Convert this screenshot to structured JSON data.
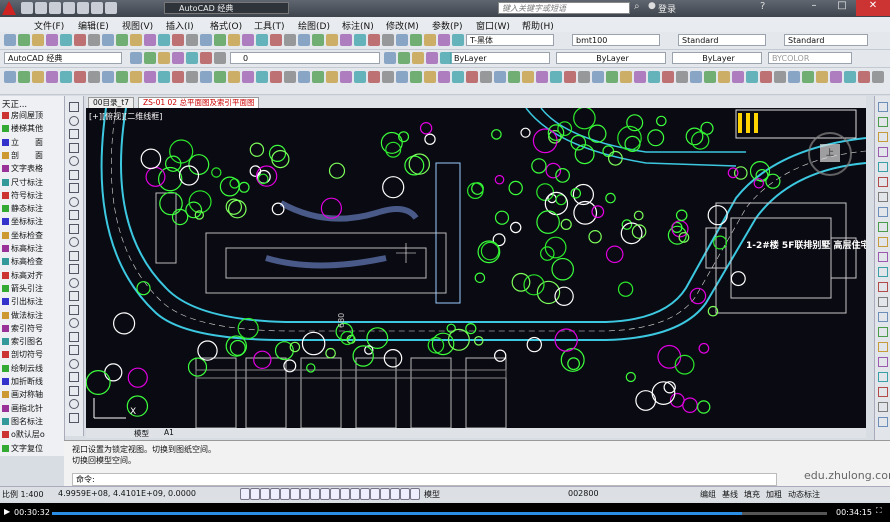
{
  "titlebar": {
    "app_combo": "AutoCAD 经典",
    "search_placeholder": "键入关键字或短语",
    "login": "登录"
  },
  "menu": [
    "文件(F)",
    "编辑(E)",
    "视图(V)",
    "插入(I)",
    "格式(O)",
    "工具(T)",
    "绘图(D)",
    "标注(N)",
    "修改(M)",
    "参数(P)",
    "窗口(W)",
    "帮助(H)"
  ],
  "toolbar1": {
    "font_style": "T-黑体",
    "dim_style": "bmt100",
    "table_style": "Standard",
    "multileader_style": "Standard"
  },
  "toolbar2": {
    "workspace": "AutoCAD 经典",
    "layer": "0",
    "color": "ByLayer",
    "linetype": "ByLayer",
    "lineweight": "ByLayer",
    "plotstyle": "BYCOLOR"
  },
  "left_panel": {
    "title": "天正...",
    "items": [
      "房间屋顶",
      "楼梯其他",
      "立　　面",
      "剖　　面",
      "文字表格",
      "尺寸标注",
      "符号标注",
      "静态标注",
      "坐标标注",
      "坐标检查",
      "标高标注",
      "标高检查",
      "标高对齐",
      "箭头引注",
      "引出标注",
      "做法标注",
      "索引符号",
      "索引图名",
      "剖切符号",
      "绘制云线",
      "加折断线",
      "画对称轴",
      "画指北针",
      "图名标注",
      "o默认层o",
      "文字复位"
    ]
  },
  "tabs": [
    "00目录_t7",
    "ZS-01 02 总平面图及索引平面图"
  ],
  "viewport_label": "[+][俯视][二维线框]",
  "building_label": "1-2#楼 5F联排别墅 高层住宅",
  "road_dim": "680",
  "sheet_tabs": [
    "模型",
    "A1"
  ],
  "command_lines": [
    "视口设置为锁定视图。切换到图纸空间。",
    "切换回模型空间。"
  ],
  "command_prompt": "命令:",
  "status": {
    "scale": "比例 1:400",
    "coords": "4.9959E+08, 4.4101E+09, 0.0000",
    "model": "模型",
    "coord_code": "002800",
    "buttons": [
      "编组",
      "基线",
      "填充",
      "加粗",
      "动态标注"
    ]
  },
  "watermark": "edu.zhulong.com",
  "player": {
    "elapsed": "00:30:32",
    "total": "00:34:15",
    "progress": 0.89
  },
  "colors": {
    "accent_green": "#3cff3c",
    "accent_magenta": "#e000e0",
    "road_cyan": "#3cc8e0",
    "canvas_bg": "#0a0a12"
  }
}
